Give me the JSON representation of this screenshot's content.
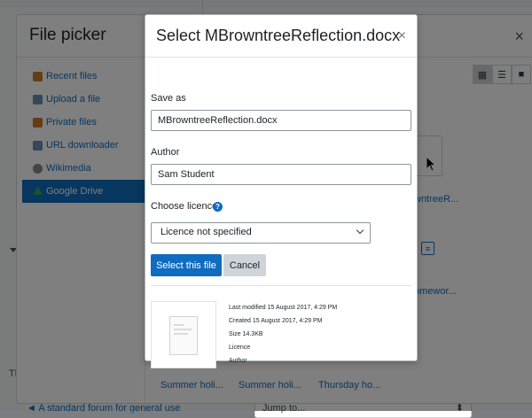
{
  "background": {
    "bottom_link": "◄ A standard forum for general use",
    "jump_to": "Jump to...",
    "left_text": "Th"
  },
  "file_picker": {
    "title": "File picker",
    "repositories": [
      {
        "label": "Recent files",
        "icon": "recent-files-icon",
        "color": "#c97a2a"
      },
      {
        "label": "Upload a file",
        "icon": "upload-icon",
        "color": "#6c8fb3"
      },
      {
        "label": "Private files",
        "icon": "private-files-icon",
        "color": "#c97a2a"
      },
      {
        "label": "URL downloader",
        "icon": "url-downloader-icon",
        "color": "#6c8fb3"
      },
      {
        "label": "Wikimedia",
        "icon": "wikimedia-icon",
        "color": "#8a8a8a"
      },
      {
        "label": "Google Drive",
        "icon": "google-drive-icon",
        "color": "#34a853"
      }
    ],
    "files": {
      "file1": "wntreeR...",
      "file2": "omewor...",
      "file3": "Summer holi...",
      "file4": "Summer holi...",
      "file5": "Thursday ho..."
    }
  },
  "dialog": {
    "title": "Select MBrowntreeReflection.docx",
    "save_as_label": "Save as",
    "save_as_value": "MBrowntreeReflection.docx",
    "author_label": "Author",
    "author_value": "Sam Student",
    "licence_label": "Choose licence",
    "licence_selected": "Licence not specified",
    "select_button": "Select this file",
    "cancel_button": "Cancel",
    "details": {
      "last_modified_label": "Last modified",
      "last_modified_value": "15 August 2017, 4:29 PM",
      "created_label": "Created",
      "created_value": "15 August 2017, 4:29 PM",
      "size_label": "Size",
      "size_value": "14.3KB",
      "licence_label": "Licence",
      "author_label": "Author"
    }
  },
  "colors": {
    "primary": "#0f6cbf",
    "secondary_button": "#ced4da",
    "overlay": "rgba(0,0,0,0.5)"
  }
}
